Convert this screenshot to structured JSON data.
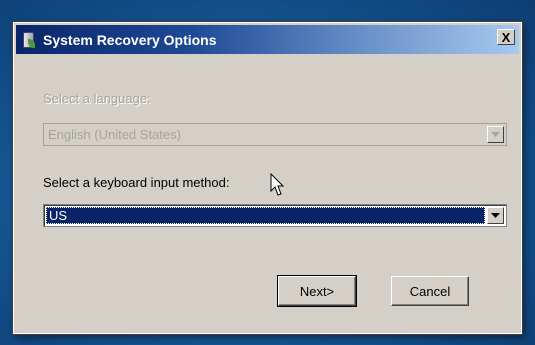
{
  "dialog": {
    "title": "System Recovery Options",
    "close_label": "X"
  },
  "language": {
    "label": "Select a language:",
    "value": "English (United States)",
    "enabled": false
  },
  "keyboard": {
    "label": "Select a keyboard input method:",
    "value": "US",
    "enabled": true
  },
  "buttons": {
    "next": "Next>",
    "cancel": "Cancel"
  },
  "icons": {
    "title": "recovery-computer-icon",
    "dropdown": "chevron-down-icon",
    "cursor": "mouse-pointer-icon"
  },
  "colors": {
    "title_gradient_start": "#0a246a",
    "title_gradient_end": "#a6caf0",
    "dialog_face": "#d4d0c8",
    "selection": "#0a246a",
    "disabled_text": "#a6a39c"
  }
}
